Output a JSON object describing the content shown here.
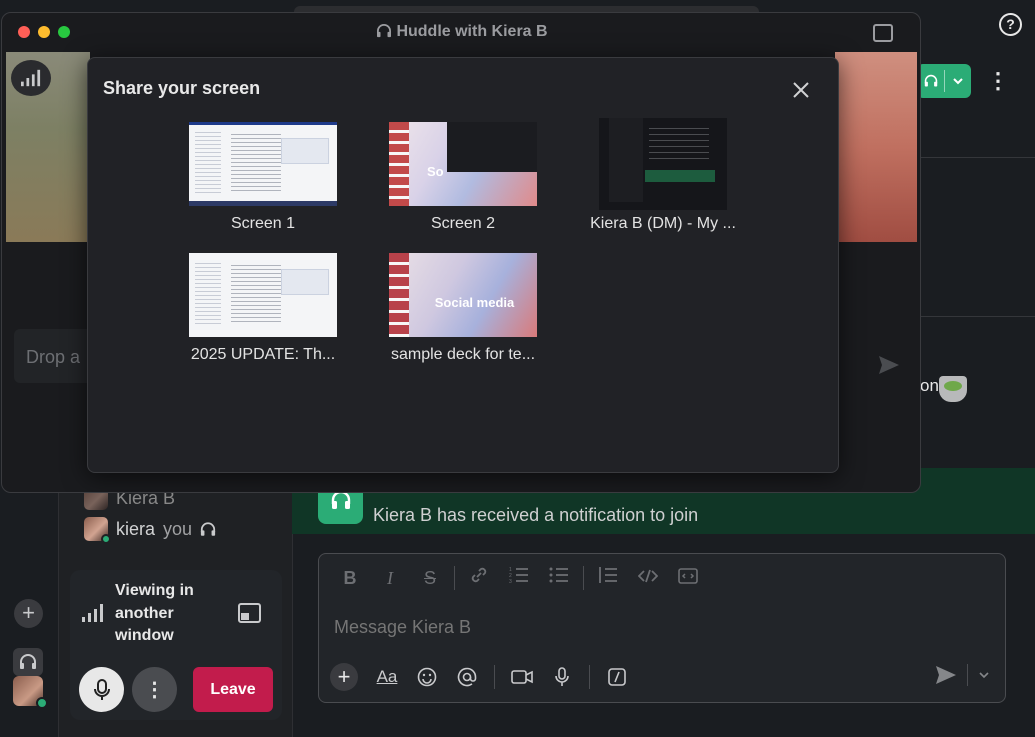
{
  "huddle_window": {
    "title": "Huddle with Kiera B"
  },
  "share_dialog": {
    "title": "Share your screen",
    "sources": [
      {
        "label": "Screen 1"
      },
      {
        "label": "Screen 2"
      },
      {
        "label": "Kiera B (DM) - My ..."
      },
      {
        "label": "2025 UPDATE: Th..."
      },
      {
        "label": "sample deck for te..."
      }
    ],
    "thumb_text": {
      "screen2_title": "So",
      "deck_title": "Social media"
    }
  },
  "background": {
    "drop_text": "Drop a",
    "right_text": "on",
    "notification": "Kiera B has received a notification to join",
    "participants": [
      {
        "name": "Kiera B"
      },
      {
        "name": "kiera",
        "suffix": "you"
      }
    ],
    "huddle_status": "Viewing in another window",
    "leave_label": "Leave",
    "message_placeholder": "Message Kiera B",
    "format_labels": {
      "bold": "B",
      "italic": "I",
      "strike": "S",
      "text": "Aa"
    }
  },
  "colors": {
    "accent_green": "#2bac76",
    "leave_red": "#c21c4c",
    "modal_bg": "#212226"
  }
}
